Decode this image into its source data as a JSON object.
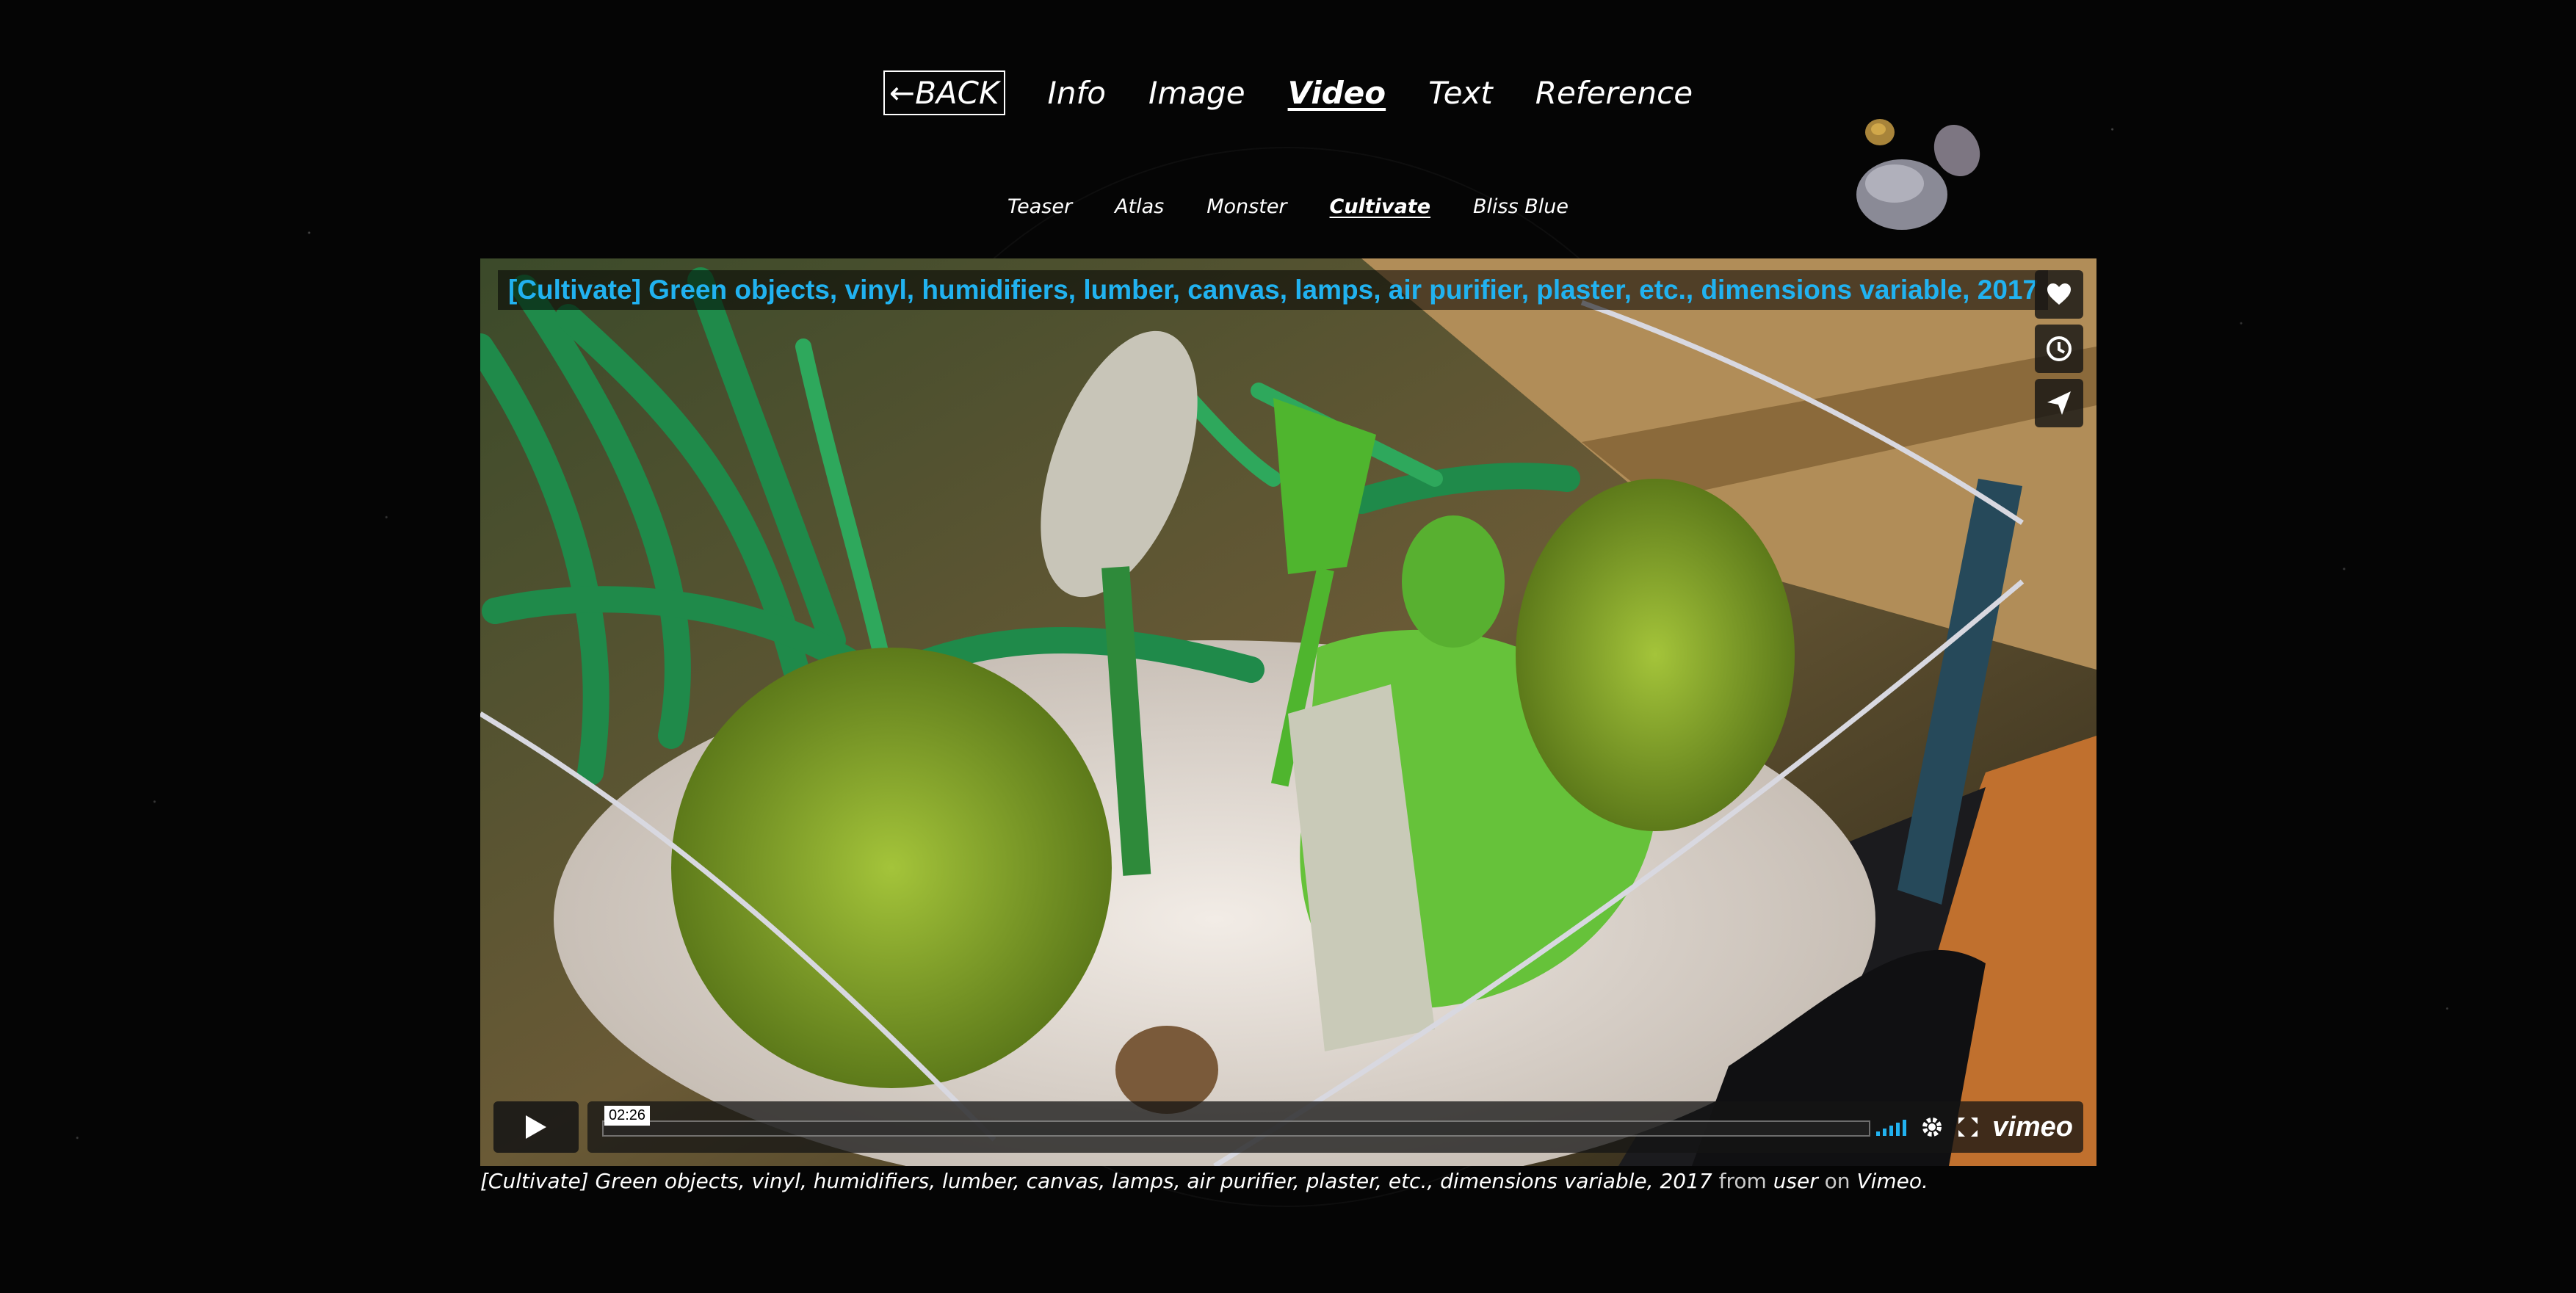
{
  "nav": {
    "back": "←BACK",
    "items": [
      "Info",
      "Image",
      "Video",
      "Text",
      "Reference"
    ],
    "active": "Video"
  },
  "subnav": {
    "items": [
      "Teaser",
      "Atlas",
      "Monster",
      "Cultivate",
      "Bliss Blue"
    ],
    "active": "Cultivate"
  },
  "player": {
    "title": "[Cultivate] Green objects, vinyl, humidifiers, lumber, canvas, lamps, air purifier, plaster, etc., dimensions variable, 2017",
    "timecode": "02:26",
    "side_buttons": [
      "heart-icon",
      "clock-icon",
      "send-icon"
    ],
    "logo": "vimeo",
    "title_color": "#21b2f0"
  },
  "caption": {
    "title": "[Cultivate] Green objects, vinyl, humidifiers, lumber, canvas, lamps, air purifier, plaster, etc., dimensions variable, 2017",
    "from": "from",
    "user": "user",
    "on": "on",
    "platform": "Vimeo",
    "end": "."
  }
}
